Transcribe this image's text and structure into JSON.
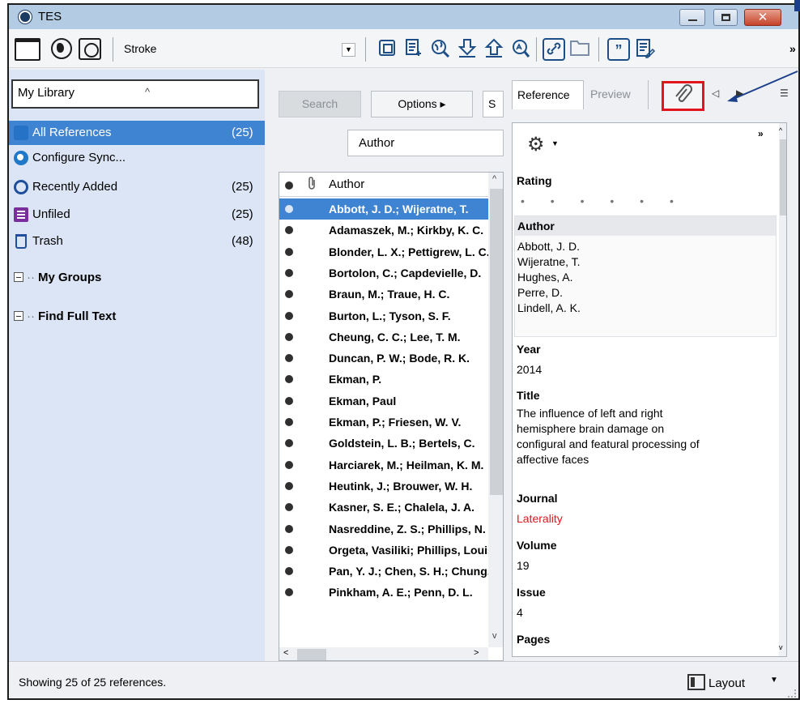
{
  "window": {
    "title": "TES"
  },
  "toolbar": {
    "style_name": "Stroke",
    "overflow": "»"
  },
  "library": {
    "selector_value": "My Library",
    "items": [
      {
        "label": "All References",
        "count": "(25)",
        "icon": "all-references-icon"
      },
      {
        "label": "Configure Sync...",
        "count": "",
        "icon": "sync-icon"
      },
      {
        "label": "Recently Added",
        "count": "(25)",
        "icon": "recently-added-icon"
      },
      {
        "label": "Unfiled",
        "count": "(25)",
        "icon": "unfiled-icon"
      },
      {
        "label": "Trash",
        "count": "(48)",
        "icon": "trash-icon"
      }
    ],
    "groups": [
      {
        "label": "My Groups"
      },
      {
        "label": "Find Full Text"
      }
    ]
  },
  "search": {
    "search_label": "Search",
    "options_label": "Options",
    "options_arrow": "▸",
    "partial_label": "S",
    "field_value": "Author"
  },
  "reflist": {
    "column": "Author",
    "rows": [
      "Abbott, J. D.; Wijeratne, T.",
      "Adamaszek, M.; Kirkby, K. C.",
      "Blonder, L. X.; Pettigrew, L. C.",
      "Bortolon, C.; Capdevielle, D.",
      "Braun, M.; Traue, H. C.",
      "Burton, L.; Tyson, S. F.",
      "Cheung, C. C.; Lee, T. M.",
      "Duncan, P. W.; Bode, R. K.",
      "Ekman, P.",
      "Ekman, Paul",
      "Ekman, P.; Friesen, W. V.",
      "Goldstein, L. B.; Bertels, C.",
      "Harciarek, M.; Heilman, K. M.",
      "Heutink, J.; Brouwer, W. H.",
      "Kasner, S. E.; Chalela, J. A.",
      "Nasreddine, Z. S.; Phillips, N. A.",
      "Orgeta, Vasiliki; Phillips, Louise H.",
      "Pan, Y. J.; Chen, S. H.; Chung, M. S.",
      "Pinkham, A. E.; Penn, D. L."
    ]
  },
  "reference": {
    "tab_reference": "Reference",
    "tab_preview": "Preview",
    "rating_label": "Rating",
    "rating_dots": "• • • • • •",
    "author_label": "Author",
    "authors": [
      "Abbott, J. D.",
      "Wijeratne, T.",
      "Hughes, A.",
      "Perre, D.",
      "Lindell, A. K."
    ],
    "year_label": "Year",
    "year": "2014",
    "title_label": "Title",
    "title_lines": [
      "The influence of left and right",
      "hemisphere brain damage on",
      "configural and featural processing of",
      "affective faces"
    ],
    "journal_label": "Journal",
    "journal": "Laterality",
    "volume_label": "Volume",
    "volume": "19",
    "issue_label": "Issue",
    "issue": "4",
    "pages_label": "Pages"
  },
  "status": {
    "text": "Showing 25 of 25 references.",
    "layout_label": "Layout"
  },
  "colors": {
    "selection": "#3f84d3",
    "highlight_box": "#e3141c",
    "journal_text": "#e3141c",
    "annotation": "#1b3f8a"
  }
}
